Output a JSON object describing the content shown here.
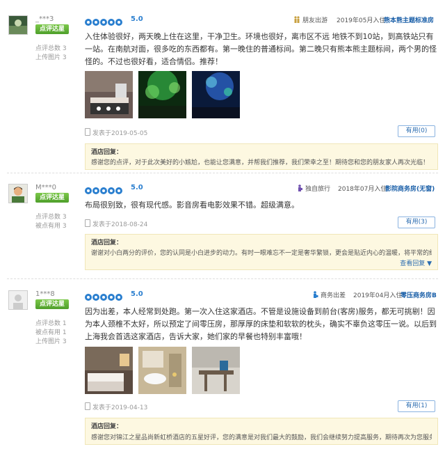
{
  "reviews": [
    {
      "username": "_***3",
      "badge": "点评达星",
      "stats": [
        "点评总数 3",
        "上传图片 3"
      ],
      "score": "5.0",
      "trip_type": "朋友出游",
      "stay_date": "2019年05月入住",
      "room_type": "熊本熊主题标准房",
      "text": "入住体验很好，两天晚上住在这里，干净卫生。环境也很好，离市区不远 地铁不到10站，到高铁站只有一站。在南航对面，很多吃的东西都有。第一晚住的普通标间。第二晚只有熊本熊主题标间，两个男的怪怪的。不过也很好看，适合情侣。推荐！",
      "photos": [
        "bedroom with pillows",
        "green lit room",
        "blue starry ceiling"
      ],
      "posted": "发表于2019-05-05",
      "useful": "有用(0)",
      "reply_title": "酒店回复：",
      "reply_text": "感谢您的点评，对于此次美好的小尴尬，也能让您满意，并帮我们推荐，我们荣幸之至！期待您和您的朋友家人再次光临！"
    },
    {
      "username": "M***0",
      "badge": "点评达星",
      "stats": [
        "点评总数 3",
        "被点有用 3"
      ],
      "score": "5.0",
      "trip_type": "独自旅行",
      "stay_date": "2018年07月入住",
      "room_type": "影院商务房(无窗)",
      "text": "布局很别致，很有现代感。影音房看电影效果不错。超级满意。",
      "posted": "发表于2018-08-24",
      "useful": "有用(3)",
      "reply_title": "酒店回复：",
      "reply_text": "谢谢对小白两分的评价，您的认同是小白进步的动力。有时一眼难忘不一定是奢华繁锁，更会是贴近内心的温暖，将平常的细节",
      "more": "查看回复 ▼"
    },
    {
      "username": "1***8",
      "badge": "点评达星",
      "stats": [
        "点评总数 1",
        "被点有用 1",
        "上传图片 3"
      ],
      "score": "5.0",
      "trip_type": "商务出差",
      "stay_date": "2019年04月入住",
      "room_type": "零压商务房B",
      "text": "因为出差，本人经常到处跑。第一次入住这家酒店。不管是设施设备到前台(客房)服务，都无可挑剔！因为本人颈椎不太好，所以预定了间零压房，那厚厚的床垫和软软的枕头，确实不辜负这零压一说。以后到上海我会首选这家酒店，告诉大家，她们家的早餐也特别丰富哦！",
      "photos": [
        "hotel room",
        "bathroom sink",
        "desk corner"
      ],
      "posted": "发表于2019-04-13",
      "useful": "有用(1)",
      "reply_title": "酒店回复：",
      "reply_text": "感谢您对锦江之星品尚新虹桥酒店的五星好评，您的满意是对我们最大的鼓励，我们会继续努力提高服务，期待再次为您服务!"
    }
  ],
  "colors": {
    "accent": "#2b7fcf",
    "badge": "#5aad31",
    "reply_bg": "#fdf8e1"
  }
}
